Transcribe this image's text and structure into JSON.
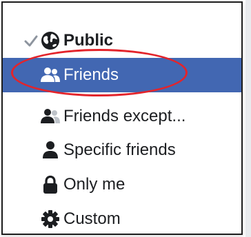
{
  "menu": {
    "items": [
      {
        "label": "Public",
        "icon": "globe-icon",
        "checked": true,
        "highlighted": false
      },
      {
        "label": "Friends",
        "icon": "friends-icon",
        "checked": false,
        "highlighted": true
      },
      {
        "label": "Friends except...",
        "icon": "friends-except-icon",
        "checked": false,
        "highlighted": false
      },
      {
        "label": "Specific friends",
        "icon": "person-icon",
        "checked": false,
        "highlighted": false
      },
      {
        "label": "Only me",
        "icon": "lock-icon",
        "checked": false,
        "highlighted": false
      },
      {
        "label": "Custom",
        "icon": "gear-icon",
        "checked": false,
        "highlighted": false
      }
    ]
  },
  "colors": {
    "highlight": "#4267b2",
    "annotation": "#e3242b",
    "text": "#1c1e21",
    "icon": "#1c1e21"
  }
}
